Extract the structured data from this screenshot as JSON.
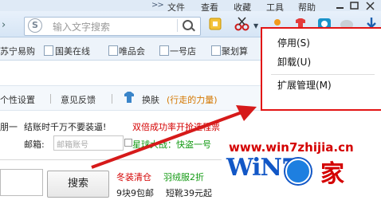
{
  "menubar": {
    "more": ">>",
    "items": [
      "文件",
      "查看",
      "收藏",
      "工具",
      "帮助"
    ]
  },
  "search": {
    "placeholder": "输入文字搜索",
    "engine_glyph": "S"
  },
  "favorites": {
    "items": [
      "苏宁易购",
      "国美在线",
      "唯品会",
      "一号店",
      "聚划算"
    ]
  },
  "links": {
    "items": [
      "个性设置",
      "意见反馈"
    ],
    "skin_label": "换肤",
    "skin_theme": "(行走的力量)"
  },
  "content": {
    "line1_prefix": "朋一",
    "line1_notice": "结账时千万不要装逼!",
    "line1_promo": "双倍成功率开抢选程票",
    "email_label": "邮箱:",
    "email_placeholder": "邮箱账号",
    "game_link": "星球大战：快盗一号",
    "search_button": "搜索",
    "promo_1": "冬装清仓",
    "promo_2": "羽绒服2折",
    "promo_3": "9块9包邮",
    "promo_4": "短靴39元起"
  },
  "context_menu": {
    "items": [
      "停用(S)",
      "卸载(U)",
      "扩展管理(M)"
    ]
  },
  "watermark": {
    "url": "www.win7zhijia.cn",
    "logo_text": "WiN7",
    "logo_suffix": "家"
  },
  "colors": {
    "menu_bg": "#dfeaf6",
    "toolbar_bg": "#d6e5f5",
    "red": "#d40000",
    "green": "#139a13",
    "highlight_border": "#e21414",
    "arrow": "#d61a1a",
    "skin_theme": "#d47700"
  },
  "icons": {
    "toolbar": [
      "cut-icon",
      "user-icon",
      "clothes-icon",
      "camera-icon",
      "cloud-icon",
      "download-icon"
    ],
    "favorites": "page-icon",
    "skin": "shirt-icon"
  }
}
